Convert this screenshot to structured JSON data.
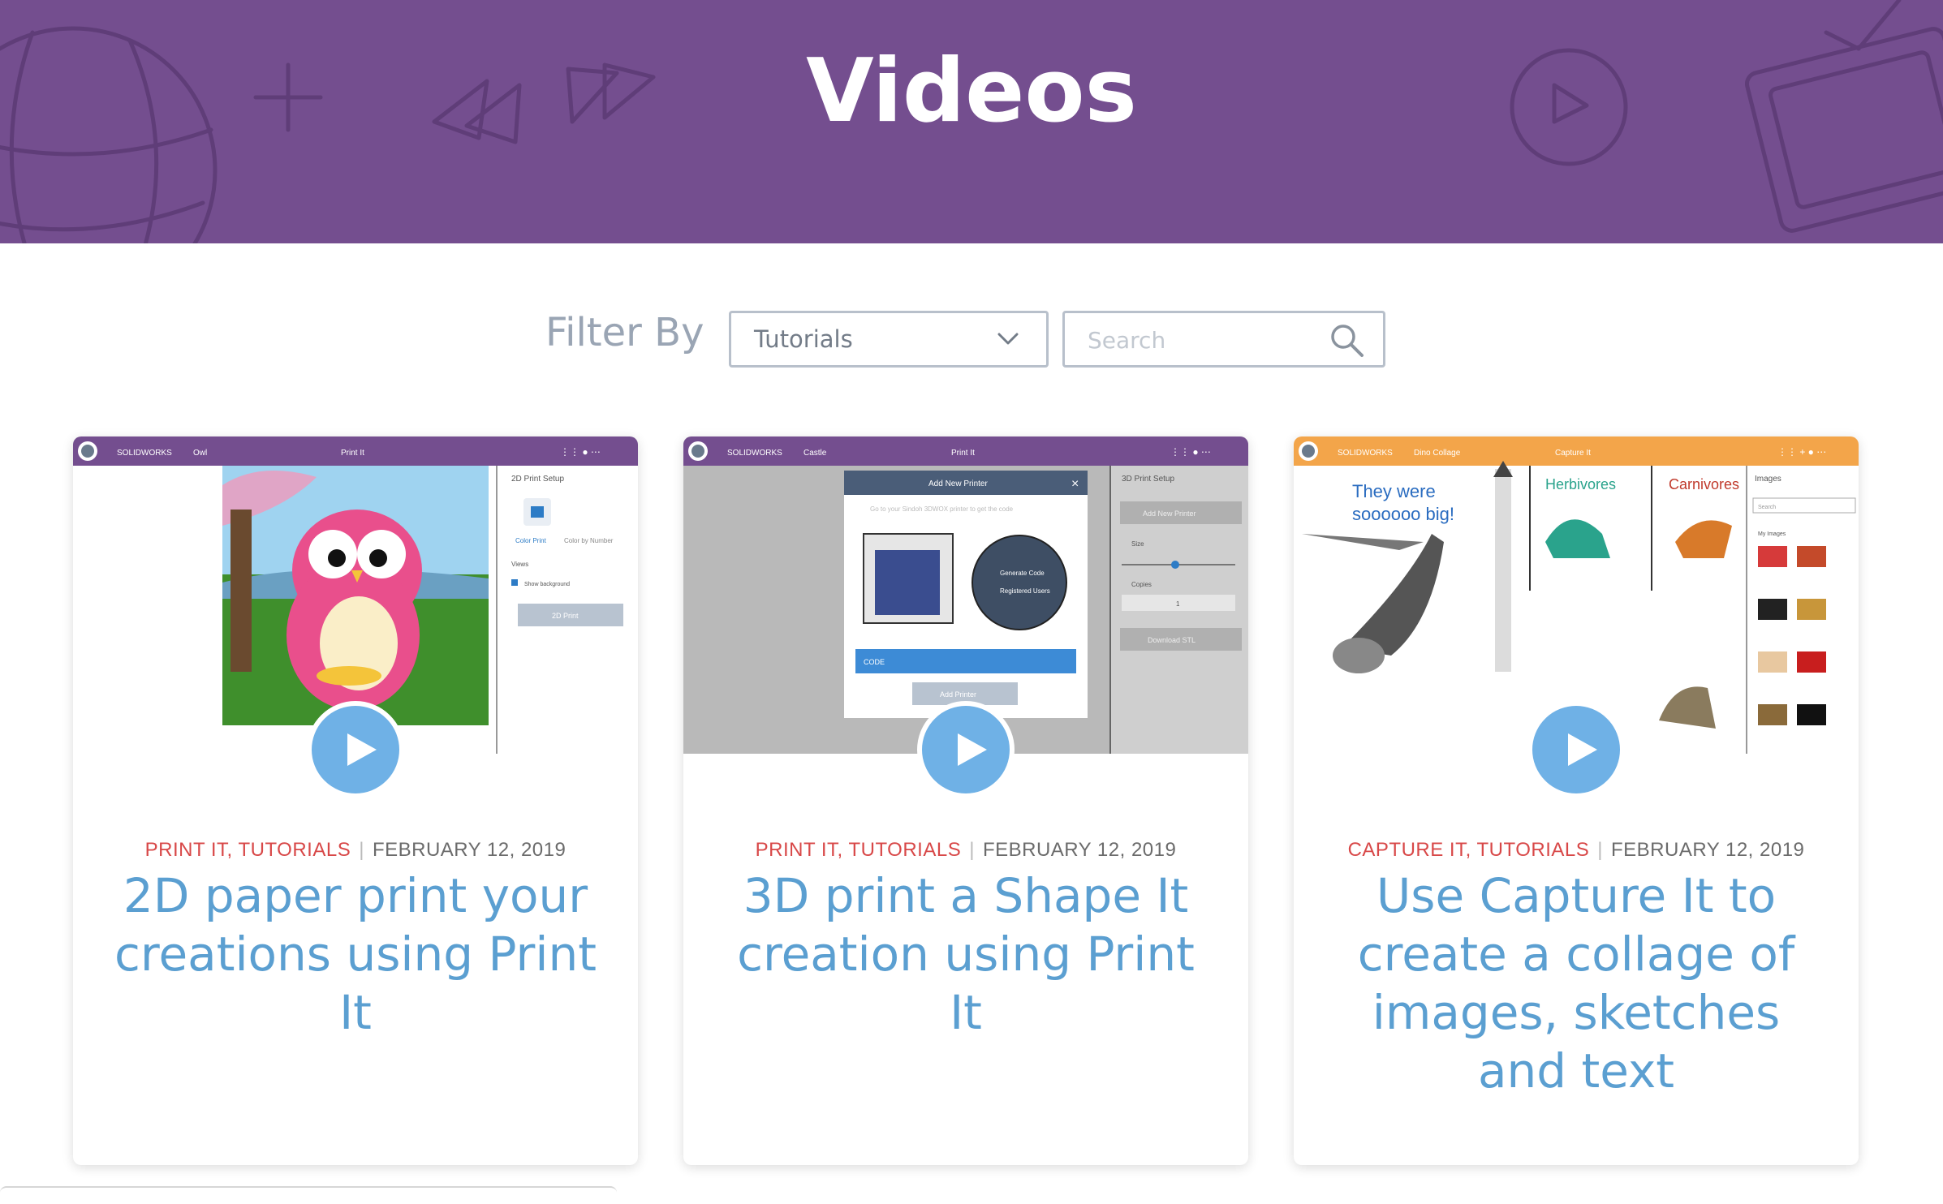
{
  "header": {
    "title": "Videos",
    "background_color": "#744e8f"
  },
  "filter": {
    "label": "Filter By",
    "category_selected": "Tutorials",
    "search_placeholder": "Search"
  },
  "videos": [
    {
      "categories": [
        "PRINT IT",
        "TUTORIALS"
      ],
      "date": "FEBRUARY 12, 2019",
      "title": "2D paper print your creations using Print It",
      "thumb": {
        "app_brand": "SOLIDWORKS",
        "doc_name": "Owl",
        "app_name": "Print It",
        "bar_color": "#744e8f",
        "panel_title": "2D Print Setup",
        "option_1": "Color Print",
        "option_2": "Color by Number",
        "views_label": "Views",
        "checkbox_label": "Show background",
        "action_button": "2D Print"
      }
    },
    {
      "categories": [
        "PRINT IT",
        "TUTORIALS"
      ],
      "date": "FEBRUARY 12, 2019",
      "title": "3D print a Shape It creation using Print It",
      "thumb": {
        "app_brand": "SOLIDWORKS",
        "doc_name": "Castle",
        "app_name": "Print It",
        "bar_color": "#744e8f",
        "panel_title": "3D Print Setup",
        "panel_button": "Add New Printer",
        "size_label": "Size",
        "copies_label": "Copies",
        "copies_value": "1",
        "download_button": "Download STL",
        "dialog_title": "Add New Printer",
        "dialog_hint": "Go to your Sindoh 3DWOX printer to get the code",
        "menu_item_1": "Generate Code",
        "menu_item_2": "Registered Users",
        "code_placeholder": "CODE",
        "dialog_button": "Add Printer"
      }
    },
    {
      "categories": [
        "CAPTURE IT",
        "TUTORIALS"
      ],
      "date": "FEBRUARY 12, 2019",
      "title": "Use Capture It to create a collage of images, sketches and text",
      "thumb": {
        "app_brand": "SOLIDWORKS",
        "doc_name": "Dino Collage",
        "app_name": "Capture It",
        "bar_color": "#f3a54a",
        "collage_text_1": "They were",
        "collage_text_2": "soooooo big!",
        "collage_text_3": "Herbivores",
        "collage_text_4": "Carnivores",
        "panel_title": "Images",
        "panel_search": "Search",
        "panel_section": "My Images"
      }
    }
  ],
  "colors": {
    "category": "#d84848",
    "title": "#5b9fd1",
    "play_button": "#6fb1e6"
  }
}
